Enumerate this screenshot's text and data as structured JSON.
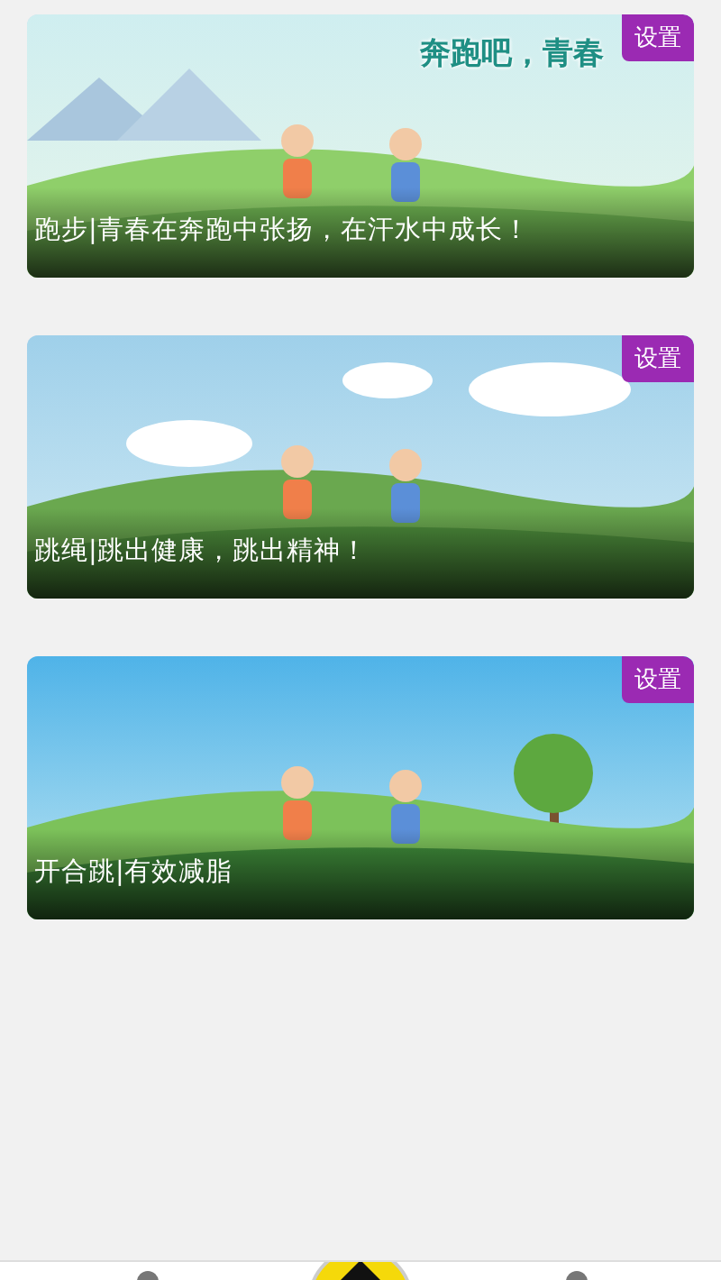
{
  "cards": [
    {
      "banner_text": "奔跑吧，青春",
      "caption": "跑步|青春在奔跑中张扬，在汗水中成长！",
      "settings_label": "设置"
    },
    {
      "caption": "跳绳|跳出健康，跳出精神！",
      "settings_label": "设置"
    },
    {
      "caption": "开合跳|有效减脂",
      "settings_label": "设置"
    }
  ]
}
